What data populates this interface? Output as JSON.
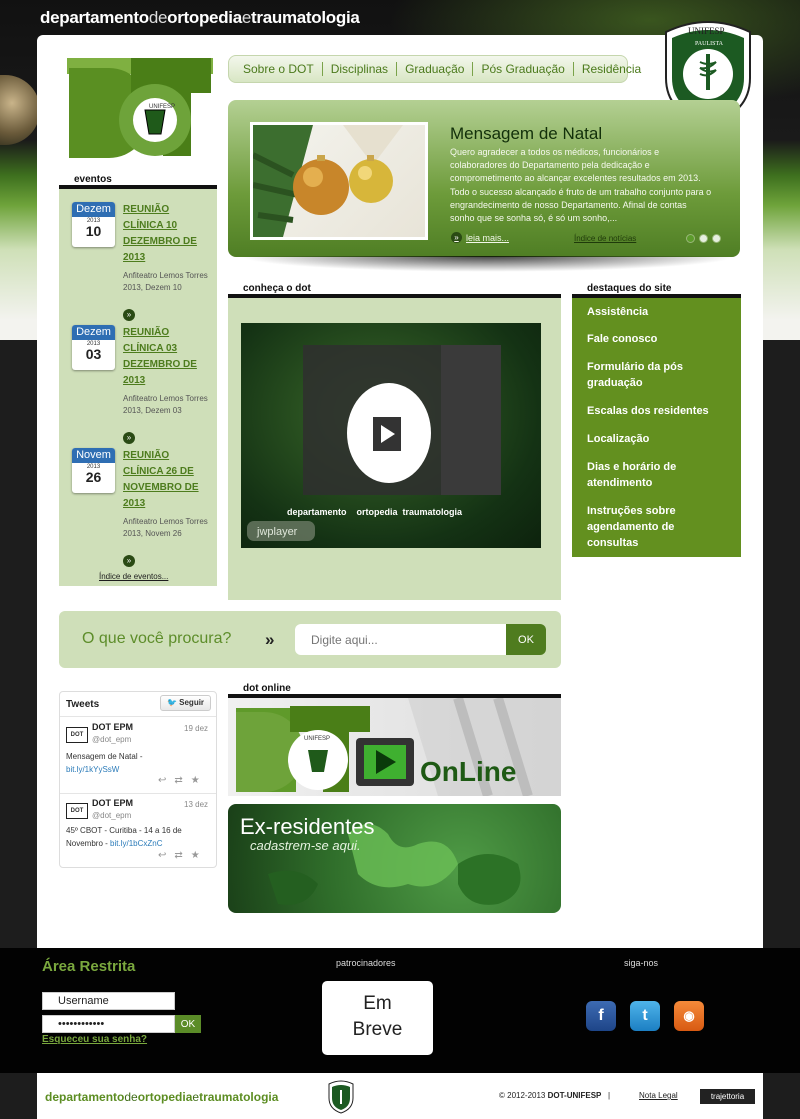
{
  "site_title": {
    "part1": "departamento",
    "part2": "de",
    "part3": "ortopedia",
    "part4": "e",
    "part5": "traumatologia"
  },
  "logo": {
    "text": "DOT",
    "small": "UNIFESP"
  },
  "seal": {
    "top": "UNIFESP",
    "ring1": "PAULISTA",
    "ring2": "ESCOLA",
    "ring3": "MEDICINA",
    "year": "1933"
  },
  "nav": [
    "Sobre o DOT",
    "Disciplinas",
    "Graduação",
    "Pós Graduação",
    "Residência"
  ],
  "slider": {
    "title": "Mensagem de Natal",
    "text": "Quero agradecer a todos os médicos, funcionários e colaboradores do Departamento pela dedicação e comprometimento ao alcançar excelentes resultados em 2013. Todo o sucesso alcançado é fruto de um trabalho conjunto para o engrandecimento de nosso Departamento. Afinal de contas sonho que se sonha só, é só um sonho,...",
    "read_more": "leia mais...",
    "news_index": "Índice de notícias"
  },
  "events": {
    "heading": "eventos",
    "items": [
      {
        "month": "Dezem",
        "year": "2013",
        "day": "10",
        "title": "REUNIÃO CLÍNICA 10 DEZEMBRO DE 2013",
        "place": "Anfiteatro Lemos Torres",
        "date": "2013, Dezem 10"
      },
      {
        "month": "Dezem",
        "year": "2013",
        "day": "03",
        "title": "REUNIÃO CLÍNICA 03 DEZEMBRO DE 2013",
        "place": "Anfiteatro Lemos Torres",
        "date": "2013, Dezem 03"
      },
      {
        "month": "Novem",
        "year": "2013",
        "day": "26",
        "title": "REUNIÃO CLÍNICA 26 DE NOVEMBRO DE 2013",
        "place": "Anfiteatro Lemos Torres",
        "date": "2013, Novem 26"
      }
    ],
    "index_link": "Índice de eventos..."
  },
  "conheca": {
    "heading": "conheça o dot",
    "video_caption": "departamento    ortopedia  traumatologia",
    "player": "jwplayer"
  },
  "destaques": {
    "heading": "destaques do site",
    "items": [
      "Assistência",
      "Fale conosco",
      "Formulário da pós graduação",
      "Escalas dos residentes",
      "Localização",
      "Dias e horário de atendimento",
      "Instruções sobre agendamento de consultas"
    ]
  },
  "search": {
    "question": "O que você procura?",
    "placeholder": "Digite aqui...",
    "button": "OK"
  },
  "tweets": {
    "heading": "Tweets",
    "follow": "Seguir",
    "items": [
      {
        "name": "DOT EPM",
        "handle": "@dot_epm",
        "date": "19 dez",
        "text": "Mensagem de Natal - ",
        "link": "bit.ly/1kYySsW"
      },
      {
        "name": "DOT EPM",
        "handle": "@dot_epm",
        "date": "13 dez",
        "text": "45º CBOT - Curitiba - 14 a 16 de Novembro - ",
        "link": "bit.ly/1bCxZnC"
      }
    ]
  },
  "dot_online": {
    "heading": "dot online",
    "label": "OnLine",
    "small": "UNIFESP"
  },
  "ex_residentes": {
    "title": "Ex-residentes",
    "subtitle": "cadastrem-se aqui."
  },
  "footer": {
    "area_title": "Área Restrita",
    "username": "Username",
    "password": "••••••••••••",
    "ok": "OK",
    "forgot": "Esqueceu sua senha?",
    "sponsors": "patrocinadores",
    "coming_soon_1": "Em",
    "coming_soon_2": "Breve",
    "follow_us": "siga-nos",
    "copyright": "© 2012-2013",
    "copyright_bold": "DOT-UNIFESP",
    "legal": "Nota Legal",
    "agency": "trajettoria"
  },
  "colors": {
    "accent_green": "#63901f",
    "panel_green": "#cfdfb9",
    "calendar_blue": "#2f6eb3"
  }
}
